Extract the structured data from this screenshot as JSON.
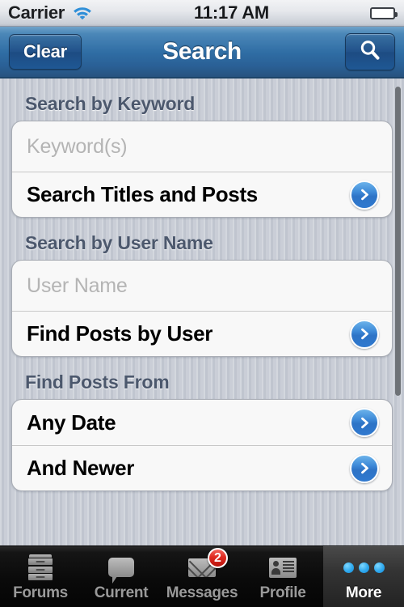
{
  "status_bar": {
    "carrier": "Carrier",
    "wifi_icon": "wifi-icon",
    "time": "11:17 AM",
    "battery_icon": "battery-icon"
  },
  "nav_bar": {
    "clear_label": "Clear",
    "title": "Search",
    "search_icon": "search-icon"
  },
  "sections": [
    {
      "header": "Search by Keyword",
      "input_placeholder": "Keyword(s)",
      "input_value": "",
      "action_label": "Search Titles and Posts"
    },
    {
      "header": "Search by User Name",
      "input_placeholder": "User Name",
      "input_value": "",
      "action_label": "Find Posts by User"
    },
    {
      "header": "Find Posts From",
      "row_one_label": "Any Date",
      "row_two_label": "And Newer"
    }
  ],
  "tab_bar": {
    "tabs": [
      {
        "label": "Forums",
        "icon": "file-cabinet-icon",
        "selected": false,
        "badge": ""
      },
      {
        "label": "Current",
        "icon": "speech-bubble-icon",
        "selected": false,
        "badge": ""
      },
      {
        "label": "Messages",
        "icon": "envelope-icon",
        "selected": false,
        "badge": "2"
      },
      {
        "label": "Profile",
        "icon": "contact-card-icon",
        "selected": false,
        "badge": ""
      },
      {
        "label": "More",
        "icon": "three-dots-icon",
        "selected": true,
        "badge": ""
      }
    ]
  },
  "colors": {
    "nav_bar_blue": "#2f6da4",
    "accent_blue": "#3e8ad8",
    "badge_red": "#e02a20",
    "header_text": "#4c586d",
    "background": "#c4c9d3"
  }
}
